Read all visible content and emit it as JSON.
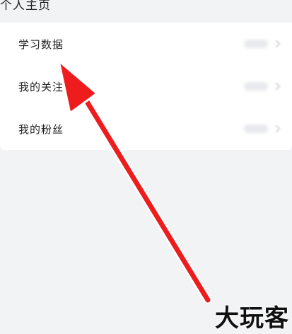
{
  "section": {
    "title": "个人主页"
  },
  "menu": {
    "items": [
      {
        "label": "学习数据",
        "icon": "chevron-right-icon"
      },
      {
        "label": "我的关注",
        "icon": "chevron-right-icon"
      },
      {
        "label": "我的粉丝",
        "icon": "chevron-right-icon"
      }
    ]
  },
  "annotation": {
    "arrow_color": "#ee1c1c"
  },
  "watermark": {
    "text": "大玩客"
  }
}
